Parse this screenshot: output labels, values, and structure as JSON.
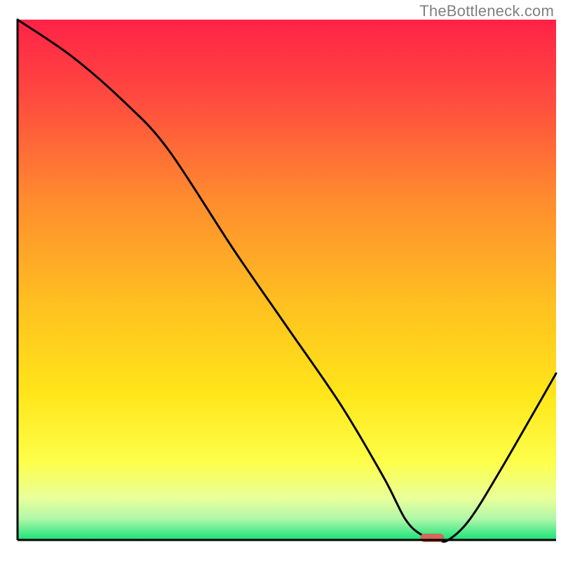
{
  "watermark": "TheBottleneck.com",
  "chart_data": {
    "type": "line",
    "title": "",
    "xlabel": "",
    "ylabel": "",
    "xlim": [
      0,
      100
    ],
    "ylim": [
      0,
      100
    ],
    "grid": false,
    "series": [
      {
        "name": "bottleneck-curve",
        "x": [
          0,
          10,
          20,
          28,
          40,
          50,
          60,
          68,
          72,
          75,
          78,
          80,
          84,
          90,
          100
        ],
        "values": [
          100,
          93,
          84,
          75,
          56,
          41,
          26,
          12,
          4,
          1,
          0,
          0,
          4,
          14,
          32
        ]
      }
    ],
    "marker": {
      "name": "optimal-point",
      "x": 77,
      "y": 0,
      "color": "#d3685c"
    },
    "gradient_stops": [
      {
        "offset": 0.0,
        "color": "#ff2247"
      },
      {
        "offset": 0.15,
        "color": "#ff4a3f"
      },
      {
        "offset": 0.35,
        "color": "#ff8d2e"
      },
      {
        "offset": 0.55,
        "color": "#ffc120"
      },
      {
        "offset": 0.72,
        "color": "#ffe61a"
      },
      {
        "offset": 0.85,
        "color": "#fdff4a"
      },
      {
        "offset": 0.92,
        "color": "#e9ff9a"
      },
      {
        "offset": 0.96,
        "color": "#aef7a9"
      },
      {
        "offset": 1.0,
        "color": "#18e37a"
      }
    ],
    "axis_color": "#000000",
    "curve_color": "#000000"
  }
}
